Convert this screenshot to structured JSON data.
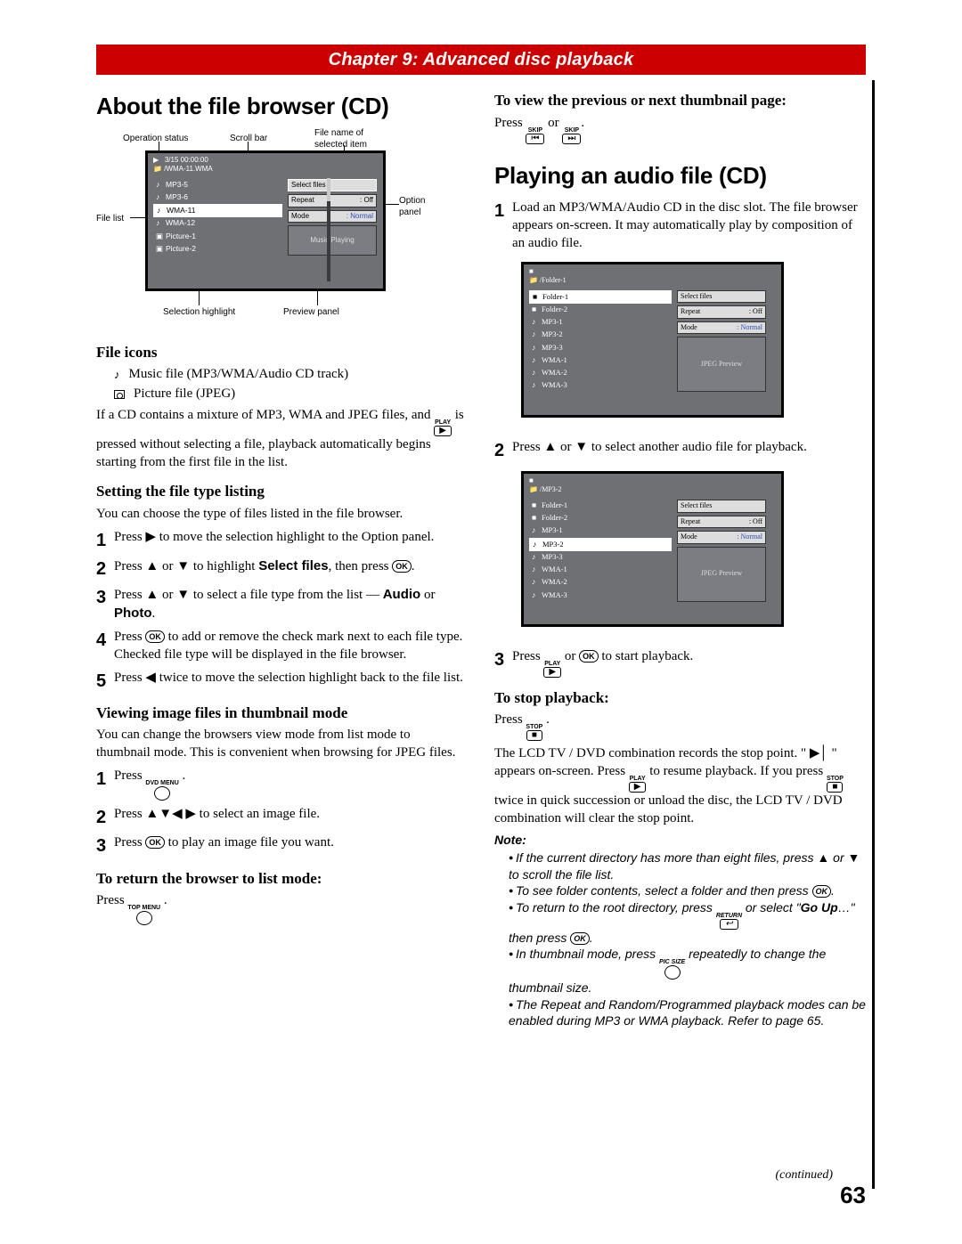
{
  "chapter_band": "Chapter 9: Advanced disc playback",
  "page_number": "63",
  "continued": "(continued)",
  "left": {
    "h1": "About the file browser (CD)",
    "diagram_labels": {
      "op_status": "Operation status",
      "scroll_bar": "Scroll bar",
      "file_name": "File name of selected item",
      "file_list": "File list",
      "option_panel": "Option panel",
      "sel_highlight": "Selection highlight",
      "preview_panel": "Preview panel"
    },
    "diagram": {
      "status": "3/15  00:00:00",
      "path": "/WMA-11.WMA",
      "items": [
        {
          "icon": "♪",
          "label": "MP3-5"
        },
        {
          "icon": "♪",
          "label": "MP3-6"
        },
        {
          "icon": "♪",
          "label": "WMA-11",
          "sel": true
        },
        {
          "icon": "♪",
          "label": "WMA-12"
        },
        {
          "icon": "▣",
          "label": "Picture-1"
        },
        {
          "icon": "▣",
          "label": "Picture-2"
        }
      ],
      "opt_selectfiles": "Select files",
      "opt_repeat_k": "Repeat",
      "opt_repeat_v": ": Off",
      "opt_mode_k": "Mode",
      "opt_mode_v": ": Normal",
      "preview": "Music Playing"
    },
    "file_icons_h": "File icons",
    "file_icons_music": "Music file (MP3/WMA/Audio CD track)",
    "file_icons_pic": "Picture file (JPEG)",
    "para_mix_1": "If a CD contains a mixture of MP3, WMA and JPEG files, and ",
    "para_mix_2": " is pressed without selecting a file, playback automatically begins starting from the first file in the list.",
    "setting_h": "Setting the file type listing",
    "setting_p": "You can choose the type of files listed in the file browser.",
    "step1": "Press ▶ to move the selection highlight to the Option panel.",
    "step2a": "Press ▲ or ▼ to highlight ",
    "step2b": "Select files",
    "step2c": ", then press ",
    "step3a": "Press ▲ or ▼ to select a file type from the list — ",
    "step3b": "Audio",
    "step3c": " or ",
    "step3d": "Photo",
    "step3e": ".",
    "step4a": "Press ",
    "step4b": " to add or remove the check mark next to each file type. Checked file type will be displayed in the file browser.",
    "step5": "Press ◀ twice to move the selection highlight back to the file list.",
    "viewing_h": "Viewing image files in thumbnail mode",
    "viewing_p": "You can change the browsers view mode from list mode to thumbnail mode. This is convenient when browsing for JPEG files.",
    "v_step1a": "Press ",
    "v_step1_btn": "DVD MENU",
    "v_step2": "Press ▲▼◀ ▶ to select an image file.",
    "v_step3a": "Press ",
    "v_step3b": " to play an image file you want.",
    "return_h": "To return the browser to list mode:",
    "return_a": "Press ",
    "return_btn": "TOP MENU"
  },
  "right": {
    "prev_next_h": "To view the previous or next thumbnail page:",
    "prev_next_a": "Press ",
    "prev_next_b": " or ",
    "skip": "SKIP",
    "h1": "Playing an audio file (CD)",
    "step1": "Load an MP3/WMA/Audio CD in the disc slot. The file browser appears on-screen. It may automatically play by composition of an audio file.",
    "diagramA": {
      "path": "/Folder-1",
      "items": [
        {
          "icon": "■",
          "label": "Folder-1",
          "sel": true
        },
        {
          "icon": "■",
          "label": "Folder-2"
        },
        {
          "icon": "♪",
          "label": "MP3-1"
        },
        {
          "icon": "♪",
          "label": "MP3-2"
        },
        {
          "icon": "♪",
          "label": "MP3-3"
        },
        {
          "icon": "♪",
          "label": "WMA-1"
        },
        {
          "icon": "♪",
          "label": "WMA-2"
        },
        {
          "icon": "♪",
          "label": "WMA-3"
        }
      ],
      "opt_selectfiles": "Select files",
      "opt_repeat_k": "Repeat",
      "opt_repeat_v": ": Off",
      "opt_mode_k": "Mode",
      "opt_mode_v": ": Normal",
      "preview": "JPEG Preview"
    },
    "step2": "Press ▲ or ▼ to select another audio file for playback.",
    "diagramB": {
      "path": "/MP3-2",
      "items": [
        {
          "icon": "■",
          "label": "Folder-1"
        },
        {
          "icon": "■",
          "label": "Folder-2"
        },
        {
          "icon": "♪",
          "label": "MP3-1"
        },
        {
          "icon": "♪",
          "label": "MP3-2",
          "sel": true
        },
        {
          "icon": "♪",
          "label": "MP3-3"
        },
        {
          "icon": "♪",
          "label": "WMA-1"
        },
        {
          "icon": "♪",
          "label": "WMA-2"
        },
        {
          "icon": "♪",
          "label": "WMA-3"
        }
      ],
      "opt_selectfiles": "Select files",
      "opt_repeat_k": "Repeat",
      "opt_repeat_v": ": Off",
      "opt_mode_k": "Mode",
      "opt_mode_v": ": Normal",
      "preview": "JPEG Preview"
    },
    "step3a": "Press ",
    "step3b": " or ",
    "step3c": " to start playback.",
    "stop_h": "To stop playback:",
    "stop_a": "Press ",
    "stop_btn_cap": "STOP",
    "stop_para1": "The LCD TV / DVD combination records the stop point. \" ",
    "stop_para2": " \" appears on-screen. Press ",
    "stop_para3": " to resume playback. If you press ",
    "stop_para4": " twice in quick succession or unload the disc, the LCD TV / DVD combination will clear the stop point.",
    "note_h": "Note:",
    "notes": [
      "If the current directory has more than eight files, press ▲ or ▼ to scroll the file list.",
      "To see folder contents, select a folder and then press OK.",
      "To return to the root directory, press RETURN or select \"Go Up…\" then press OK.",
      "In thumbnail mode, press PIC SIZE repeatedly to change the thumbnail size.",
      "The Repeat and Random/Programmed playback modes can be enabled during MP3 or WMA playback. Refer to page 65."
    ]
  }
}
